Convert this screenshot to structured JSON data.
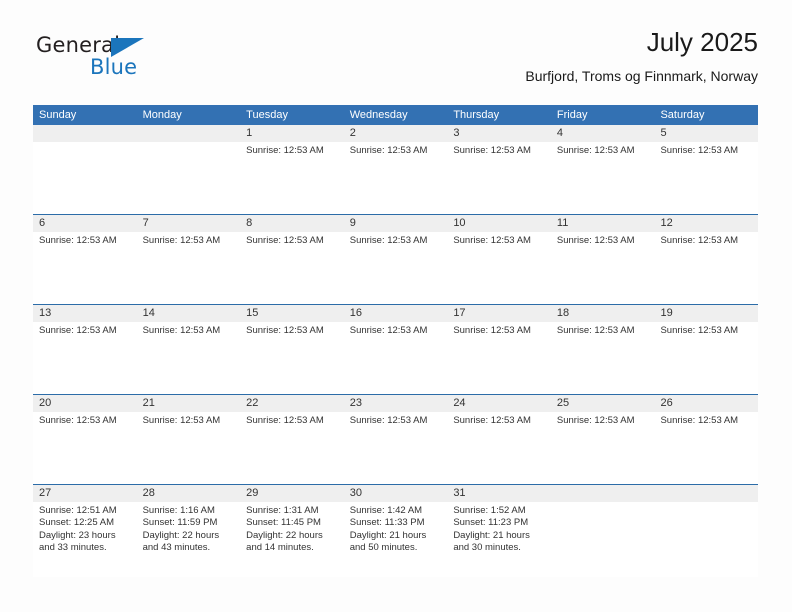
{
  "brand": {
    "name_part1": "General",
    "name_part2": "Blue",
    "triangle_icon": "triangle-icon",
    "accent_color": "#1b75bc"
  },
  "header": {
    "title": "July 2025",
    "subtitle": "Burfjord, Troms og Finnmark, Norway"
  },
  "colors": {
    "header_blue": "#3371b3",
    "separator_blue": "#2c6ca8",
    "day_band_gray": "#efefef",
    "page_background": "#fdfdfd"
  },
  "weekdays": [
    "Sunday",
    "Monday",
    "Tuesday",
    "Wednesday",
    "Thursday",
    "Friday",
    "Saturday"
  ],
  "weeks": [
    [
      {
        "day": "",
        "lines": []
      },
      {
        "day": "",
        "lines": []
      },
      {
        "day": "1",
        "lines": [
          "Sunrise: 12:53 AM"
        ]
      },
      {
        "day": "2",
        "lines": [
          "Sunrise: 12:53 AM"
        ]
      },
      {
        "day": "3",
        "lines": [
          "Sunrise: 12:53 AM"
        ]
      },
      {
        "day": "4",
        "lines": [
          "Sunrise: 12:53 AM"
        ]
      },
      {
        "day": "5",
        "lines": [
          "Sunrise: 12:53 AM"
        ]
      }
    ],
    [
      {
        "day": "6",
        "lines": [
          "Sunrise: 12:53 AM"
        ]
      },
      {
        "day": "7",
        "lines": [
          "Sunrise: 12:53 AM"
        ]
      },
      {
        "day": "8",
        "lines": [
          "Sunrise: 12:53 AM"
        ]
      },
      {
        "day": "9",
        "lines": [
          "Sunrise: 12:53 AM"
        ]
      },
      {
        "day": "10",
        "lines": [
          "Sunrise: 12:53 AM"
        ]
      },
      {
        "day": "11",
        "lines": [
          "Sunrise: 12:53 AM"
        ]
      },
      {
        "day": "12",
        "lines": [
          "Sunrise: 12:53 AM"
        ]
      }
    ],
    [
      {
        "day": "13",
        "lines": [
          "Sunrise: 12:53 AM"
        ]
      },
      {
        "day": "14",
        "lines": [
          "Sunrise: 12:53 AM"
        ]
      },
      {
        "day": "15",
        "lines": [
          "Sunrise: 12:53 AM"
        ]
      },
      {
        "day": "16",
        "lines": [
          "Sunrise: 12:53 AM"
        ]
      },
      {
        "day": "17",
        "lines": [
          "Sunrise: 12:53 AM"
        ]
      },
      {
        "day": "18",
        "lines": [
          "Sunrise: 12:53 AM"
        ]
      },
      {
        "day": "19",
        "lines": [
          "Sunrise: 12:53 AM"
        ]
      }
    ],
    [
      {
        "day": "20",
        "lines": [
          "Sunrise: 12:53 AM"
        ]
      },
      {
        "day": "21",
        "lines": [
          "Sunrise: 12:53 AM"
        ]
      },
      {
        "day": "22",
        "lines": [
          "Sunrise: 12:53 AM"
        ]
      },
      {
        "day": "23",
        "lines": [
          "Sunrise: 12:53 AM"
        ]
      },
      {
        "day": "24",
        "lines": [
          "Sunrise: 12:53 AM"
        ]
      },
      {
        "day": "25",
        "lines": [
          "Sunrise: 12:53 AM"
        ]
      },
      {
        "day": "26",
        "lines": [
          "Sunrise: 12:53 AM"
        ]
      }
    ],
    [
      {
        "day": "27",
        "lines": [
          "Sunrise: 12:51 AM",
          "Sunset: 12:25 AM",
          "Daylight: 23 hours",
          "and 33 minutes."
        ]
      },
      {
        "day": "28",
        "lines": [
          "Sunrise: 1:16 AM",
          "Sunset: 11:59 PM",
          "Daylight: 22 hours",
          "and 43 minutes."
        ]
      },
      {
        "day": "29",
        "lines": [
          "Sunrise: 1:31 AM",
          "Sunset: 11:45 PM",
          "Daylight: 22 hours",
          "and 14 minutes."
        ]
      },
      {
        "day": "30",
        "lines": [
          "Sunrise: 1:42 AM",
          "Sunset: 11:33 PM",
          "Daylight: 21 hours",
          "and 50 minutes."
        ]
      },
      {
        "day": "31",
        "lines": [
          "Sunrise: 1:52 AM",
          "Sunset: 11:23 PM",
          "Daylight: 21 hours",
          "and 30 minutes."
        ]
      },
      {
        "day": "",
        "lines": []
      },
      {
        "day": "",
        "lines": []
      }
    ]
  ]
}
